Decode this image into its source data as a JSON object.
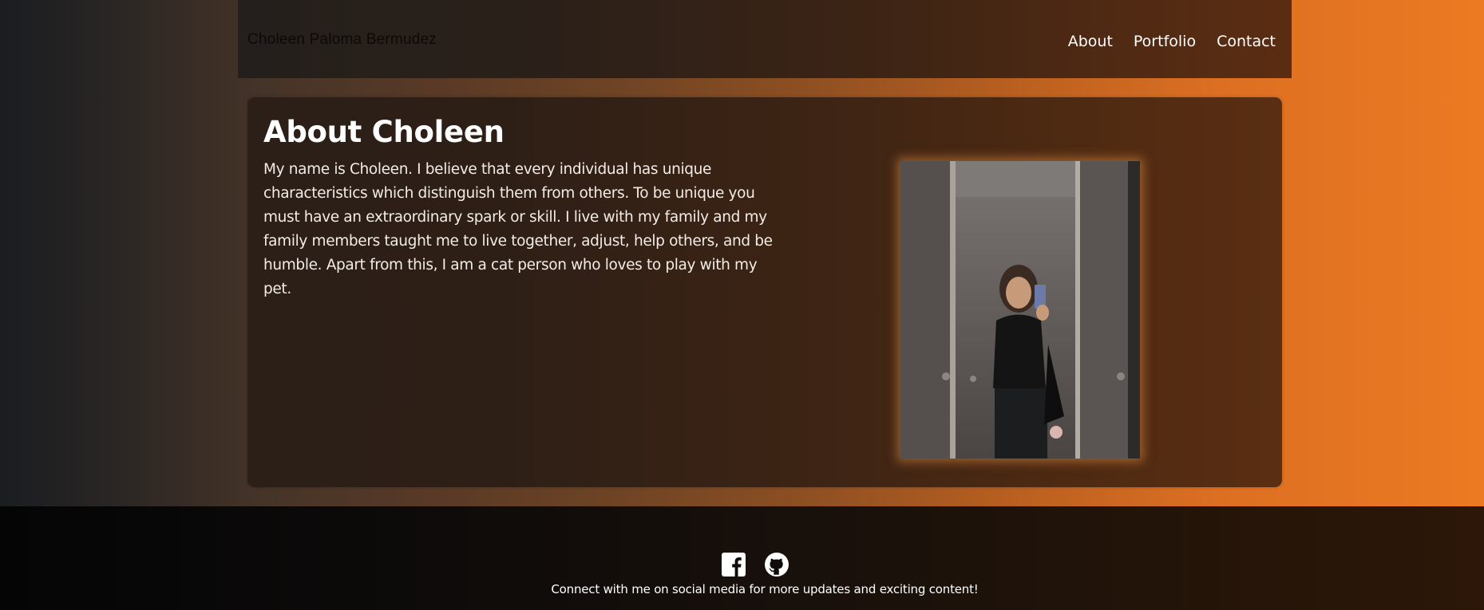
{
  "header": {
    "brand": "Choleen Paloma Bermudez",
    "nav": [
      {
        "label": "About"
      },
      {
        "label": "Portfolio"
      },
      {
        "label": "Contact"
      }
    ]
  },
  "about": {
    "title": "About Choleen",
    "paragraph": "My name is Choleen. I believe that every individual has unique characteristics which distinguish them from others. To be unique you must have an extraordinary spark or skill. I live with my family and my family members taught me to live together, adjust, help others, and be humble. Apart from this, I am a cat person who loves to play with my pet."
  },
  "footer": {
    "social_icons": [
      "facebook-icon",
      "github-icon"
    ],
    "text": "Connect with me on social media for more updates and exciting content!"
  },
  "colors": {
    "accent_orange": "#ea7a22",
    "text_white": "#ffffff"
  }
}
